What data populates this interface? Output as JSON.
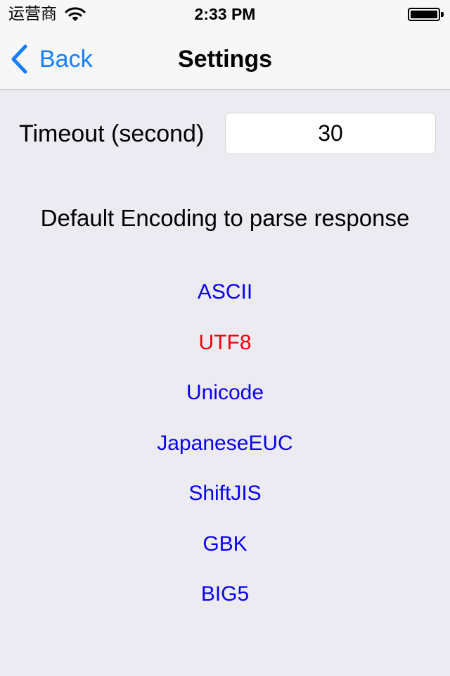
{
  "status_bar": {
    "carrier": "运营商",
    "wifi_icon": "wifi-icon",
    "time": "2:33 PM",
    "battery_icon": "battery-full-icon",
    "battery_level": 1.0
  },
  "nav": {
    "back_label": "Back",
    "back_icon": "chevron-left-icon",
    "title": "Settings",
    "accent_color": "#147efb"
  },
  "timeout": {
    "label": "Timeout (second)",
    "value": "30"
  },
  "encoding": {
    "heading": "Default Encoding to parse response",
    "options": [
      {
        "label": "ASCII",
        "selected": false
      },
      {
        "label": "UTF8",
        "selected": true
      },
      {
        "label": "Unicode",
        "selected": false
      },
      {
        "label": "JapaneseEUC",
        "selected": false
      },
      {
        "label": "ShiftJIS",
        "selected": false
      },
      {
        "label": "GBK",
        "selected": false
      },
      {
        "label": "BIG5",
        "selected": false
      }
    ],
    "option_color": "#0a00f4",
    "selected_color": "#f5000d"
  }
}
